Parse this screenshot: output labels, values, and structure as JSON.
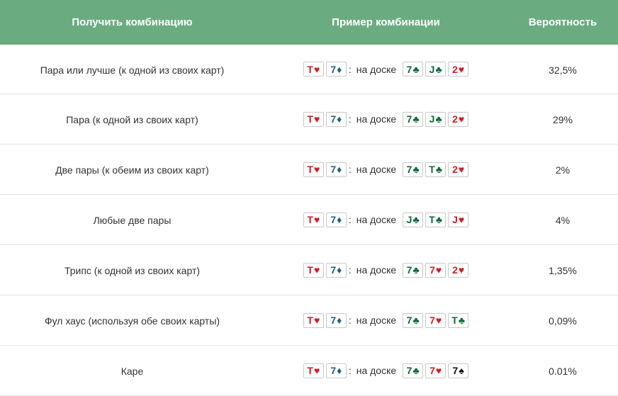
{
  "header": {
    "combo": "Получить комбинацию",
    "example": "Пример комбинации",
    "probability": "Вероятность"
  },
  "colors": {
    "header_bg": "#6aac80",
    "hearts": "#d71920",
    "diamonds": "#1f5f8b",
    "clubs": "#0d6b3a",
    "spades": "#111111"
  },
  "on_board_label": "на доске",
  "separator": ":",
  "rows": [
    {
      "combo": "Пара или лучше (к одной из своих карт)",
      "hand": [
        {
          "rank": "T",
          "suit": "♥",
          "color": "red"
        },
        {
          "rank": "7",
          "suit": "♦",
          "color": "blue"
        }
      ],
      "board": [
        {
          "rank": "7",
          "suit": "♣",
          "color": "green"
        },
        {
          "rank": "J",
          "suit": "♣",
          "color": "green"
        },
        {
          "rank": "2",
          "suit": "♥",
          "color": "red"
        }
      ],
      "probability": "32,5%"
    },
    {
      "combo": "Пара (к одной из своих карт)",
      "hand": [
        {
          "rank": "T",
          "suit": "♥",
          "color": "red"
        },
        {
          "rank": "7",
          "suit": "♦",
          "color": "blue"
        }
      ],
      "board": [
        {
          "rank": "7",
          "suit": "♣",
          "color": "green"
        },
        {
          "rank": "J",
          "suit": "♣",
          "color": "green"
        },
        {
          "rank": "2",
          "suit": "♥",
          "color": "red"
        }
      ],
      "probability": "29%"
    },
    {
      "combo": "Две пары (к обеим из своих карт)",
      "hand": [
        {
          "rank": "T",
          "suit": "♥",
          "color": "red"
        },
        {
          "rank": "7",
          "suit": "♦",
          "color": "blue"
        }
      ],
      "board": [
        {
          "rank": "7",
          "suit": "♣",
          "color": "green"
        },
        {
          "rank": "T",
          "suit": "♣",
          "color": "green"
        },
        {
          "rank": "2",
          "suit": "♥",
          "color": "red"
        }
      ],
      "probability": "2%"
    },
    {
      "combo": "Любые две пары",
      "hand": [
        {
          "rank": "T",
          "suit": "♥",
          "color": "red"
        },
        {
          "rank": "7",
          "suit": "♦",
          "color": "blue"
        }
      ],
      "board": [
        {
          "rank": "J",
          "suit": "♣",
          "color": "green"
        },
        {
          "rank": "T",
          "suit": "♣",
          "color": "green"
        },
        {
          "rank": "J",
          "suit": "♥",
          "color": "red"
        }
      ],
      "probability": "4%"
    },
    {
      "combo": "Трипс (к одной из своих карт)",
      "hand": [
        {
          "rank": "T",
          "suit": "♥",
          "color": "red"
        },
        {
          "rank": "7",
          "suit": "♦",
          "color": "blue"
        }
      ],
      "board": [
        {
          "rank": "7",
          "suit": "♣",
          "color": "green"
        },
        {
          "rank": "7",
          "suit": "♥",
          "color": "red"
        },
        {
          "rank": "2",
          "suit": "♥",
          "color": "red"
        }
      ],
      "probability": "1,35%"
    },
    {
      "combo": "Фул хаус (используя обе своих карты)",
      "hand": [
        {
          "rank": "T",
          "suit": "♥",
          "color": "red"
        },
        {
          "rank": "7",
          "suit": "♦",
          "color": "blue"
        }
      ],
      "board": [
        {
          "rank": "7",
          "suit": "♣",
          "color": "green"
        },
        {
          "rank": "7",
          "suit": "♥",
          "color": "red"
        },
        {
          "rank": "T",
          "suit": "♣",
          "color": "green"
        }
      ],
      "probability": "0,09%"
    },
    {
      "combo": "Каре",
      "hand": [
        {
          "rank": "T",
          "suit": "♥",
          "color": "red"
        },
        {
          "rank": "7",
          "suit": "♦",
          "color": "blue"
        }
      ],
      "board": [
        {
          "rank": "7",
          "suit": "♣",
          "color": "green"
        },
        {
          "rank": "7",
          "suit": "♥",
          "color": "red"
        },
        {
          "rank": "7",
          "suit": "♠",
          "color": "black"
        }
      ],
      "probability": "0.01%"
    }
  ]
}
